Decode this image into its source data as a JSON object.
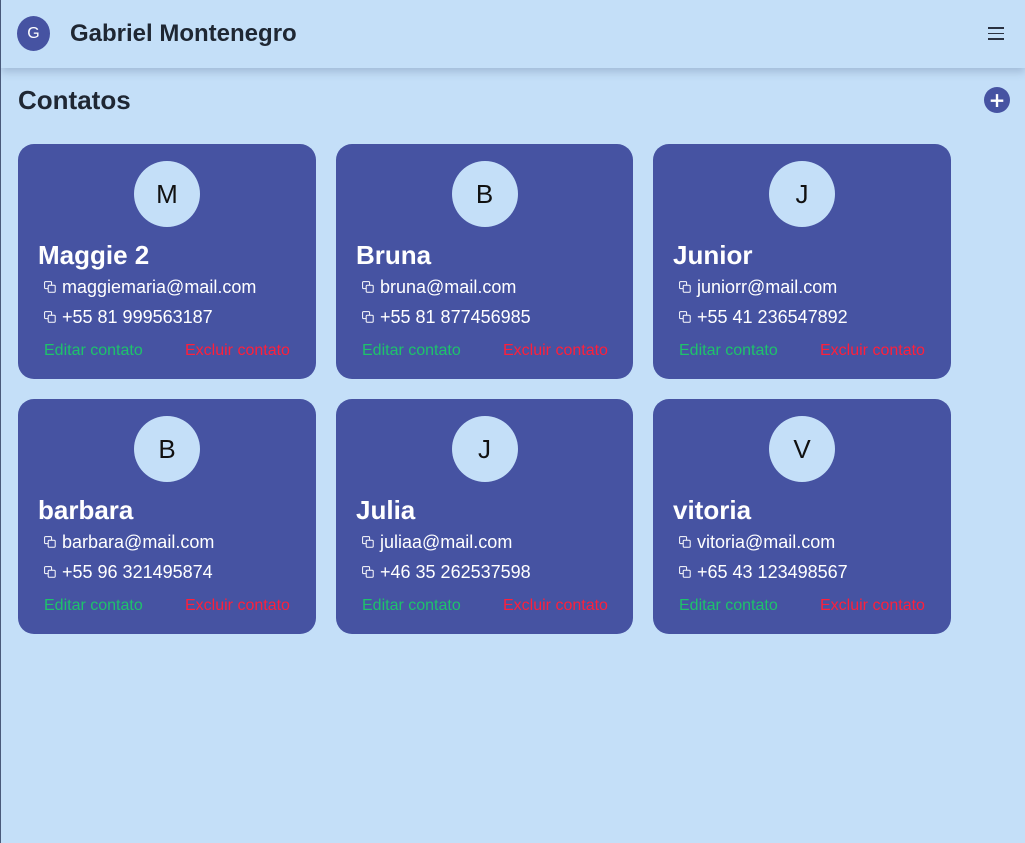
{
  "header": {
    "avatar_initial": "G",
    "user_name": "Gabriel Montenegro",
    "menu_icon": "hamburger-menu-icon"
  },
  "main": {
    "title": "Contatos",
    "add_button_label": "+"
  },
  "contacts": [
    {
      "initial": "M",
      "name": "Maggie 2",
      "email": "maggiemaria@mail.com",
      "phone": "+55 81 999563187",
      "edit_label": "Editar contato",
      "delete_label": "Excluir contato"
    },
    {
      "initial": "B",
      "name": "Bruna",
      "email": "bruna@mail.com",
      "phone": "+55 81 877456985",
      "edit_label": "Editar contato",
      "delete_label": "Excluir contato"
    },
    {
      "initial": "J",
      "name": "Junior",
      "email": "juniorr@mail.com",
      "phone": "+55 41 236547892",
      "edit_label": "Editar contato",
      "delete_label": "Excluir contato"
    },
    {
      "initial": "B",
      "name": "barbara",
      "email": "barbara@mail.com",
      "phone": "+55 96 321495874",
      "edit_label": "Editar contato",
      "delete_label": "Excluir contato"
    },
    {
      "initial": "J",
      "name": "Julia",
      "email": "juliaa@mail.com",
      "phone": "+46 35 262537598",
      "edit_label": "Editar contato",
      "delete_label": "Excluir contato"
    },
    {
      "initial": "V",
      "name": "vitoria",
      "email": "vitoria@mail.com",
      "phone": "+65 43 123498567",
      "edit_label": "Editar contato",
      "delete_label": "Excluir contato"
    }
  ],
  "colors": {
    "background": "#c4dff8",
    "card": "#4653a2",
    "edit": "#1ec26b",
    "delete": "#ff1f3a",
    "text_dark": "#1f2733"
  }
}
